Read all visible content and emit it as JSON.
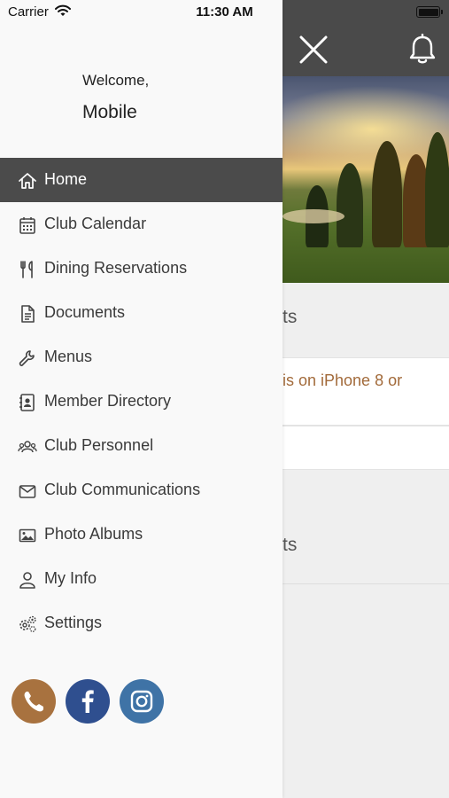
{
  "status_bar": {
    "carrier": "Carrier",
    "time": "11:30 AM"
  },
  "drawer": {
    "welcome": "Welcome,",
    "username": "Mobile",
    "items": [
      {
        "label": "Home",
        "icon": "home-icon",
        "active": true
      },
      {
        "label": "Club Calendar",
        "icon": "calendar-icon"
      },
      {
        "label": "Dining Reservations",
        "icon": "utensils-icon"
      },
      {
        "label": "Documents",
        "icon": "document-icon"
      },
      {
        "label": "Menus",
        "icon": "wrench-icon"
      },
      {
        "label": "Member Directory",
        "icon": "contact-book-icon"
      },
      {
        "label": "Club Personnel",
        "icon": "people-icon"
      },
      {
        "label": "Club Communications",
        "icon": "envelope-icon"
      },
      {
        "label": "Photo Albums",
        "icon": "photo-icon"
      },
      {
        "label": "My Info",
        "icon": "user-icon"
      },
      {
        "label": "Settings",
        "icon": "gears-icon"
      }
    ],
    "social": [
      {
        "name": "phone-icon",
        "color": "#a8723f"
      },
      {
        "name": "facebook-icon",
        "color": "#2f4f8f"
      },
      {
        "name": "instagram-icon",
        "color": "#3f73a6"
      }
    ]
  },
  "background": {
    "section_title_1": "ts",
    "card_text": "is on iPhone 8 or",
    "section_title_2": "ts"
  },
  "colors": {
    "navbar": "#4a4a4a",
    "active_item": "#4b4b4b",
    "link": "#a26a3a"
  }
}
